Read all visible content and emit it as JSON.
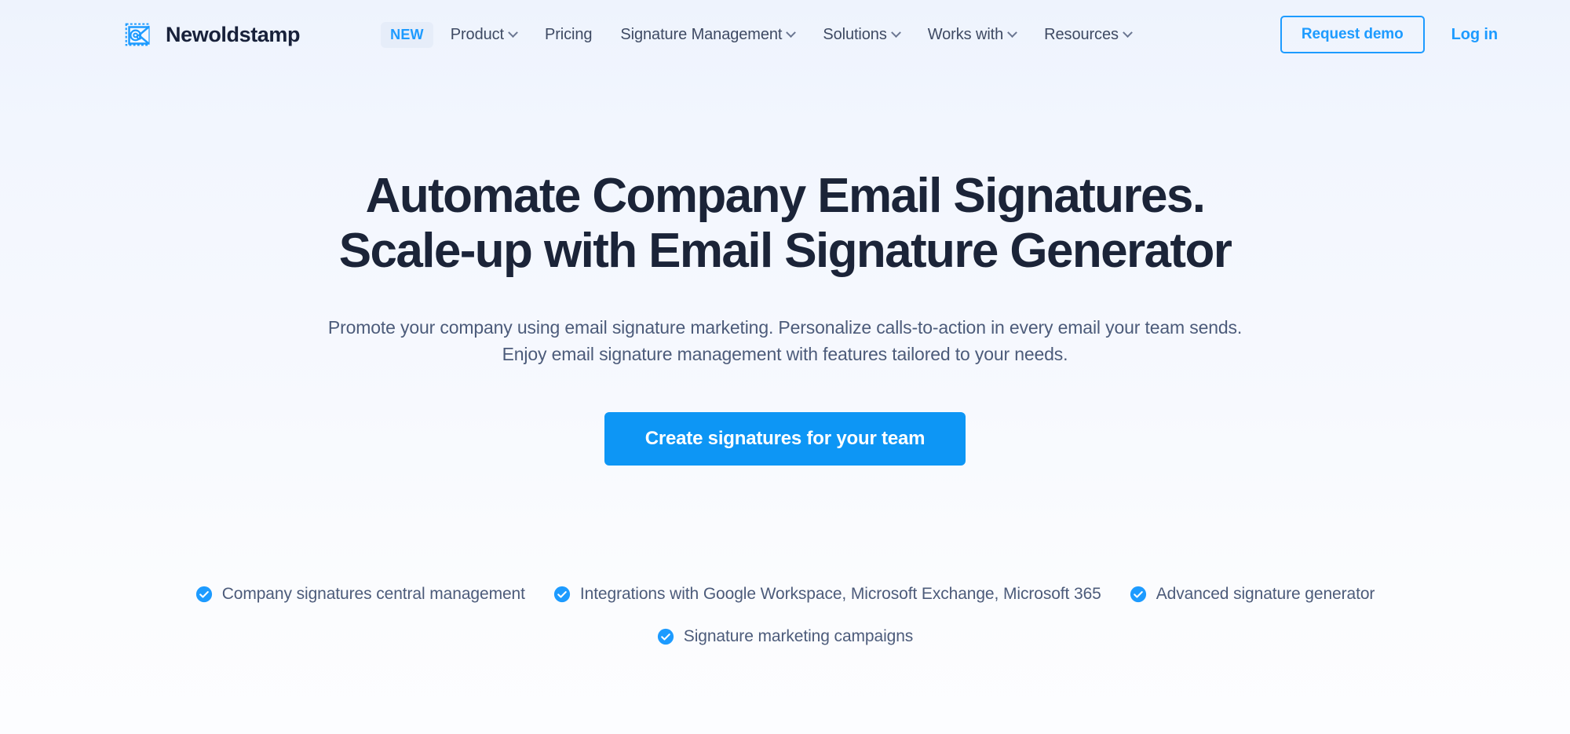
{
  "brand": {
    "name": "Newoldstamp",
    "logo_icon": "envelope-at-stamp-icon",
    "accent_color": "#1D9BFF"
  },
  "nav": {
    "badge": "NEW",
    "items": [
      {
        "label": "Product",
        "has_dropdown": true
      },
      {
        "label": "Pricing",
        "has_dropdown": false
      },
      {
        "label": "Signature Management",
        "has_dropdown": true
      },
      {
        "label": "Solutions",
        "has_dropdown": true
      },
      {
        "label": "Works with",
        "has_dropdown": true
      },
      {
        "label": "Resources",
        "has_dropdown": true
      }
    ],
    "request_demo": "Request demo",
    "log_in": "Log in"
  },
  "hero": {
    "title_line1": "Automate Company Email Signatures.",
    "title_line2": "Scale-up with Email Signature Generator",
    "subtitle_line1": "Promote your company using email signature marketing. Personalize calls-to-action in every email your team sends.",
    "subtitle_line2": "Enjoy email signature management with features tailored to your needs.",
    "cta_label": "Create signatures for your team",
    "cta_color": "#0D96F5"
  },
  "features": {
    "check_icon": "check-circle-icon",
    "check_color": "#1D9BFF",
    "row1": [
      "Company signatures central management",
      "Integrations with Google Workspace, Microsoft Exchange, Microsoft 365",
      "Advanced signature generator"
    ],
    "row2": [
      "Signature marketing campaigns"
    ]
  }
}
